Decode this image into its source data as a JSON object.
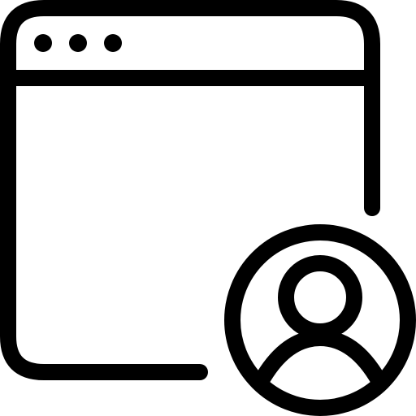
{
  "icon": {
    "name": "browser-window-user-icon",
    "stroke_color": "#000000",
    "background_color": "#ffffff"
  },
  "window": {
    "name": "browser-window",
    "control_dots": [
      "dot-1",
      "dot-2",
      "dot-3"
    ]
  },
  "user_badge": {
    "name": "user-avatar-icon"
  }
}
